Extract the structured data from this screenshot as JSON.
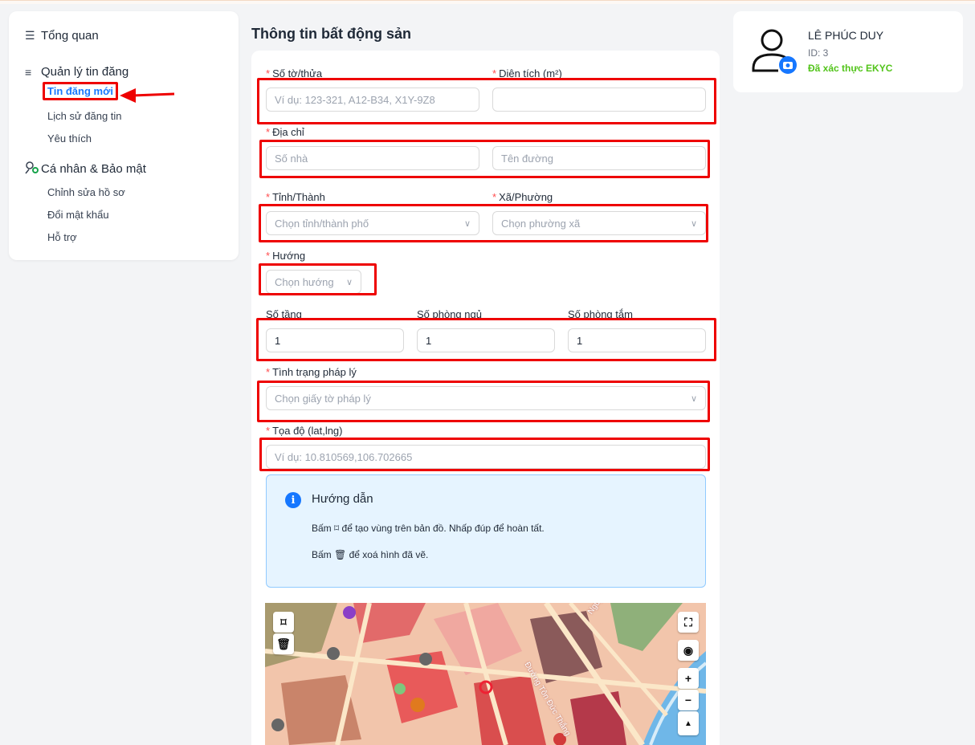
{
  "sidebar": {
    "overview": "Tổng quan",
    "listing_group": "Quản lý tin đăng",
    "listing_items": [
      "Tin đăng mới",
      "Lịch sử đăng tin",
      "Yêu thích"
    ],
    "account_group": "Cá nhân & Bảo mật",
    "account_items": [
      "Chỉnh sửa hồ sơ",
      "Đổi mật khẩu",
      "Hỗ trợ"
    ]
  },
  "main": {
    "title": "Thông tin bất động sản"
  },
  "form": {
    "parcel_label": "Số tờ/thửa",
    "parcel_placeholder": "Ví dụ: 123-321, A12-B34, X1Y-9Z8",
    "area_label": "Diện tích (m²)",
    "area_value": "",
    "address_label": "Địa chỉ",
    "house_placeholder": "Số nhà",
    "street_placeholder": "Tên đường",
    "province_label": "Tỉnh/Thành",
    "province_placeholder": "Chọn tỉnh/thành phố",
    "ward_label": "Xã/Phường",
    "ward_placeholder": "Chọn phường xã",
    "direction_label": "Hướng",
    "direction_placeholder": "Chọn hướng",
    "floors_label": "Số tầng",
    "floors_value": "1",
    "bedrooms_label": "Số phòng ngủ",
    "bedrooms_value": "1",
    "bathrooms_label": "Số phòng tắm",
    "bathrooms_value": "1",
    "legal_label": "Tình trạng pháp lý",
    "legal_placeholder": "Chọn giấy tờ pháp lý",
    "coords_label": "Tọa độ (lat,lng)",
    "coords_placeholder": "Ví dụ: 10.810569,106.702665"
  },
  "guide": {
    "title": "Hướng dẫn",
    "line1_a": "Bấm",
    "line1_b": "để tạo vùng trên bản đồ. Nhấp đúp để hoàn tất.",
    "line2_a": "Bấm",
    "line2_b": "để xoá hình đã vẽ."
  },
  "map": {
    "labels": [
      "Đường Tôn Đức Thắng",
      "Nguyễn Hữu Cảnh"
    ],
    "zoom_in": "+",
    "zoom_out": "−"
  },
  "profile": {
    "name": "LÊ PHÚC DUY",
    "id": "ID: 3",
    "verified": "Đã xác thực EKYC"
  },
  "colors": {
    "accent": "#1677ff",
    "required": "#ff4d4f",
    "annotation": "#ee0000",
    "verified": "#52c41a"
  }
}
